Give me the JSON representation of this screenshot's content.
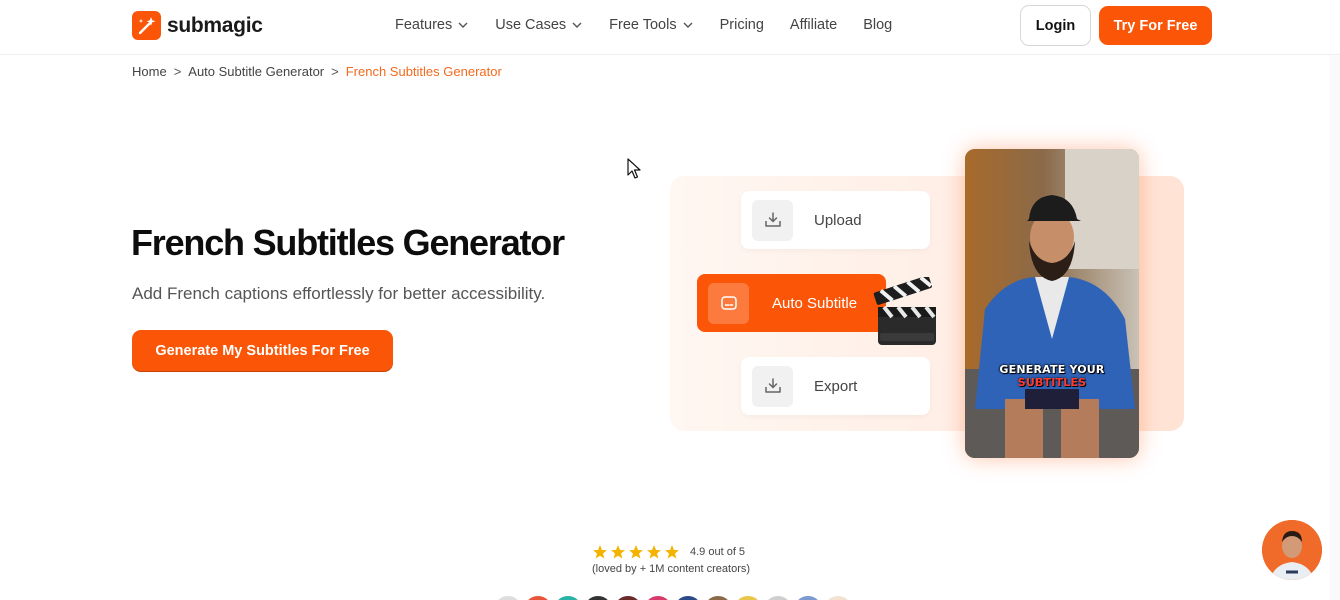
{
  "brand": {
    "name": "submagic",
    "accent": "#fb5608"
  },
  "nav": {
    "items": [
      {
        "label": "Features",
        "has_dropdown": true
      },
      {
        "label": "Use Cases",
        "has_dropdown": true
      },
      {
        "label": "Free Tools",
        "has_dropdown": true
      },
      {
        "label": "Pricing",
        "has_dropdown": false
      },
      {
        "label": "Affiliate",
        "has_dropdown": false
      },
      {
        "label": "Blog",
        "has_dropdown": false
      }
    ],
    "login_label": "Login",
    "try_label": "Try For Free"
  },
  "breadcrumb": {
    "items": [
      "Home",
      "Auto Subtitle Generator",
      "French Subtitles Generator"
    ],
    "separator": ">"
  },
  "hero": {
    "title": "French Subtitles Generator",
    "subtitle": "Add French captions effortlessly for better accessibility.",
    "cta_label": "Generate My Subtitles For Free"
  },
  "illustration": {
    "steps": [
      {
        "label": "Upload",
        "icon": "upload-tray-icon"
      },
      {
        "label": "Auto Subtitle",
        "icon": "subtitles-icon"
      },
      {
        "label": "Export",
        "icon": "export-tray-icon"
      }
    ],
    "phone_caption_line1": "GENERATE YOUR",
    "phone_caption_line2": "SUBTITLES"
  },
  "rating": {
    "stars": 5,
    "score_text": "4.9 out of 5",
    "subtext": "(loved by + 1M content creators)"
  }
}
